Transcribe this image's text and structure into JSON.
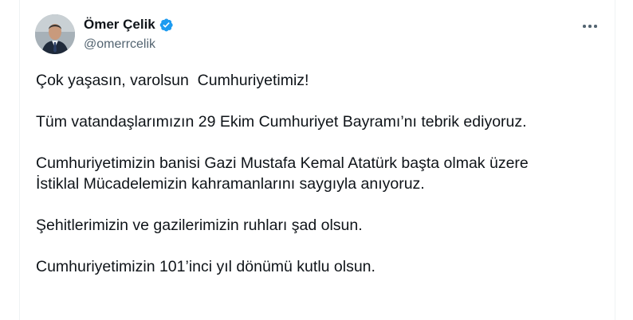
{
  "tweet": {
    "author": {
      "display_name": "Ömer Çelik",
      "handle": "@omerrcelik",
      "verified_icon": "verified-badge-icon",
      "avatar": "avatar"
    },
    "more_icon": "more-horizontal-icon",
    "paragraphs": [
      {
        "lines": [
          "Çok yaşasın, varolsun  Cumhuriyetimiz!"
        ]
      },
      {
        "lines": [
          "Tüm vatandaşlarımızın 29 Ekim Cumhuriyet Bayramı’nı tebrik ediyoruz."
        ]
      },
      {
        "lines": [
          "Cumhuriyetimizin banisi Gazi Mustafa Kemal Atatürk başta olmak üzere",
          "İstiklal Mücadelemizin kahramanlarını saygıyla anıyoruz."
        ]
      },
      {
        "lines": [
          "Şehitlerimizin ve gazilerimizin ruhları şad olsun."
        ]
      },
      {
        "lines": [
          "Cumhuriyetimizin 101’inci yıl dönümü kutlu olsun."
        ]
      }
    ]
  },
  "colors": {
    "text_primary": "#0f1419",
    "text_secondary": "#536471",
    "verified_blue": "#1d9bf0",
    "border": "#eff3f4"
  }
}
